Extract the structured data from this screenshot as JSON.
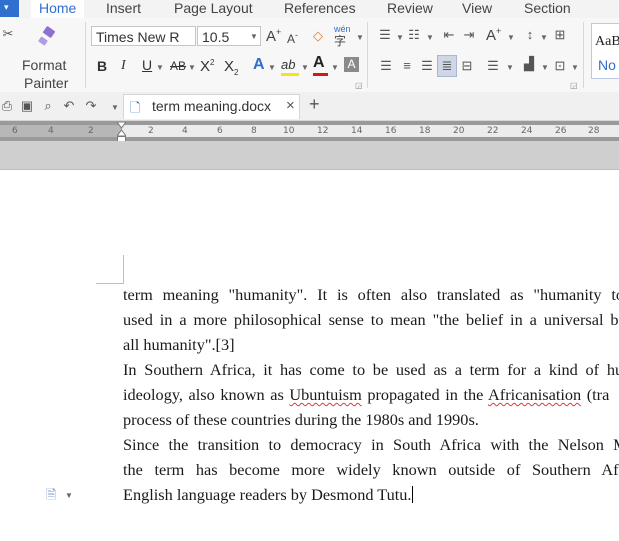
{
  "menu": {
    "tabs": [
      "Home",
      "Insert",
      "Page Layout",
      "References",
      "Review",
      "View",
      "Section"
    ],
    "active_tab": "Home"
  },
  "clipboard": {
    "format_painter_line1": "Format",
    "format_painter_line2": "Painter"
  },
  "font": {
    "name": "Times New R",
    "size": "10.5",
    "bold": "B",
    "italic": "I",
    "underline": "U",
    "strike": "AB",
    "superscript": "X",
    "subscript": "X",
    "grow": "A",
    "shrink": "A",
    "phonetic": "wén",
    "font_color_letter": "A",
    "highlight_letter": "ab"
  },
  "styles": {
    "preview_top": "AaB",
    "preview_bottom": "No"
  },
  "document_tab": {
    "name": "term meaning.docx",
    "close": "×",
    "new_tab": "+"
  },
  "ruler": {
    "ticks": [
      "6",
      "4",
      "2",
      "2",
      "4",
      "6",
      "8",
      "10",
      "12",
      "14",
      "16",
      "18",
      "20",
      "22",
      "24",
      "26",
      "28"
    ]
  },
  "document": {
    "paragraphs": [
      {
        "lines": [
          "term meaning \"humanity\". It is often also translated as \"humanity towa",
          "used in a more philosophical sense to mean \"the belief in a universal bond",
          "all humanity\".[3]"
        ]
      },
      {
        "lines": [
          "In Southern Africa, it has come to be used as a term for a kind of huma"
        ],
        "line2_before": "ideology, also known as ",
        "line2_term1": "Ubuntuism",
        "line2_middle": " propagated in the ",
        "line2_term2": "Africanisation",
        "line2_after": " (tra",
        "line3": "process of these countries during the 1980s and 1990s."
      },
      {
        "lines": [
          "Since the transition to democracy in South Africa with the Nelson Man",
          "the term has become more widely known outside of Southern Africa",
          "English language readers by Desmond Tutu."
        ]
      }
    ]
  },
  "colors": {
    "accent": "#2f6fce",
    "font_color_bar": "#d01919",
    "highlight_bar": "#f5e31a",
    "spell_underline": "#d04040"
  }
}
